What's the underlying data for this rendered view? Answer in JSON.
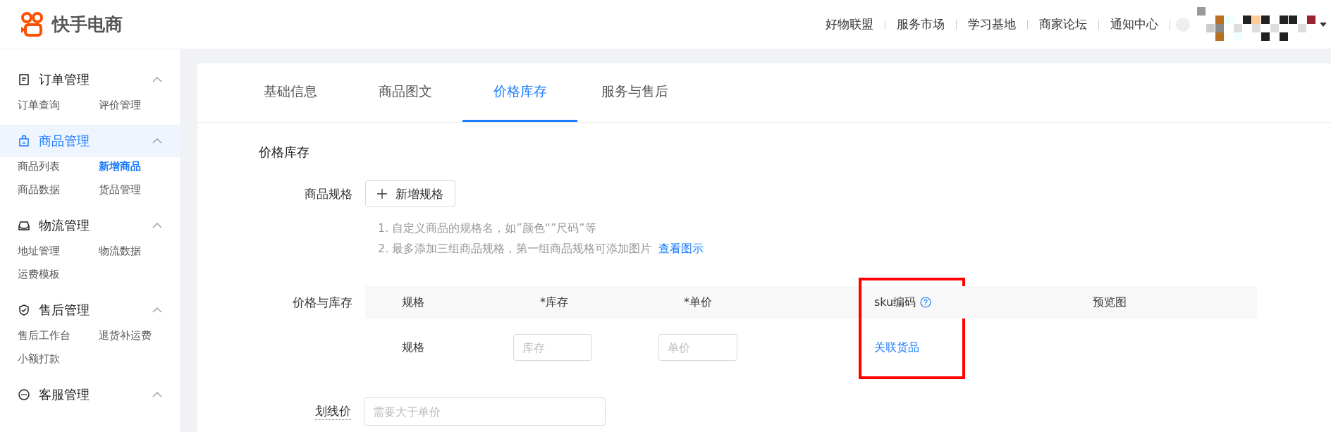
{
  "header": {
    "logo_text": "快手电商",
    "nav": [
      "好物联盟",
      "服务市场",
      "学习基地",
      "商家论坛",
      "通知中心"
    ]
  },
  "sidebar": {
    "groups": [
      {
        "title": "订单管理",
        "selected": false,
        "expanded": true,
        "items": [
          {
            "label": "订单查询",
            "selected": false
          },
          {
            "label": "评价管理",
            "selected": false
          }
        ]
      },
      {
        "title": "商品管理",
        "selected": true,
        "expanded": true,
        "items": [
          {
            "label": "商品列表",
            "selected": false
          },
          {
            "label": "新增商品",
            "selected": true
          },
          {
            "label": "商品数据",
            "selected": false
          },
          {
            "label": "货品管理",
            "selected": false
          }
        ]
      },
      {
        "title": "物流管理",
        "selected": false,
        "expanded": true,
        "items": [
          {
            "label": "地址管理",
            "selected": false
          },
          {
            "label": "物流数据",
            "selected": false
          },
          {
            "label": "运费模板",
            "selected": false
          }
        ]
      },
      {
        "title": "售后管理",
        "selected": false,
        "expanded": true,
        "items": [
          {
            "label": "售后工作台",
            "selected": false
          },
          {
            "label": "退货补运费",
            "selected": false
          },
          {
            "label": "小额打款",
            "selected": false
          }
        ]
      },
      {
        "title": "客服管理",
        "selected": false,
        "expanded": true
      }
    ]
  },
  "tabs": [
    {
      "label": "基础信息",
      "selected": false
    },
    {
      "label": "商品图文",
      "selected": false
    },
    {
      "label": "价格库存",
      "selected": true
    },
    {
      "label": "服务与售后",
      "selected": false
    }
  ],
  "section_title": "价格库存",
  "spec": {
    "label": "商品规格",
    "button": "新增规格",
    "hints": [
      "1. 自定义商品的规格名，如”颜色“”尺码”等",
      "2. 最多添加三组商品规格，第一组商品规格可添加图片"
    ],
    "hint_link": "查看图示"
  },
  "table": {
    "label": "价格与库存",
    "columns": [
      {
        "title": "规格",
        "highlighted": false
      },
      {
        "title": "*库存",
        "highlighted": false
      },
      {
        "title": "*单价",
        "highlighted": false
      },
      {
        "title": "sku编码",
        "highlighted": true,
        "help": true
      },
      {
        "title": "预览图",
        "highlighted": false
      }
    ],
    "rows": [
      {
        "spec": "规格",
        "stock_placeholder": "库存",
        "price_placeholder": "单价",
        "sku_link": "关联货品"
      }
    ]
  },
  "strike_price": {
    "label": "划线价",
    "placeholder": "需要大于单价"
  }
}
